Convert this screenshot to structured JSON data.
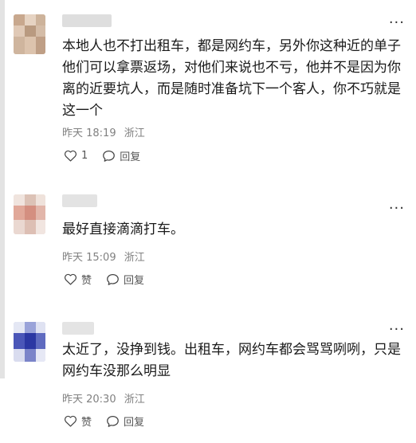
{
  "comments": [
    {
      "text": "本地人也不打出租车，都是网约车，另外你这种近的单子他们可以拿票返场，对他们来说也不亏，他并不是因为你离的近要坑人，而是随时准备坑下一个客人，你不巧就是这一个",
      "date": "昨天 18:19",
      "location": "浙江",
      "like_label": "1",
      "reply_label": "回复"
    },
    {
      "text": "最好直接滴滴打车。",
      "date": "昨天 15:09",
      "location": "浙江",
      "like_label": "赞",
      "reply_label": "回复"
    },
    {
      "text": "太近了，没挣到钱。出租车，网约车都会骂骂咧咧，只是网约车没那么明显",
      "date": "昨天 20:30",
      "location": "浙江",
      "like_label": "赞",
      "reply_label": "回复"
    }
  ],
  "more_label": "···"
}
